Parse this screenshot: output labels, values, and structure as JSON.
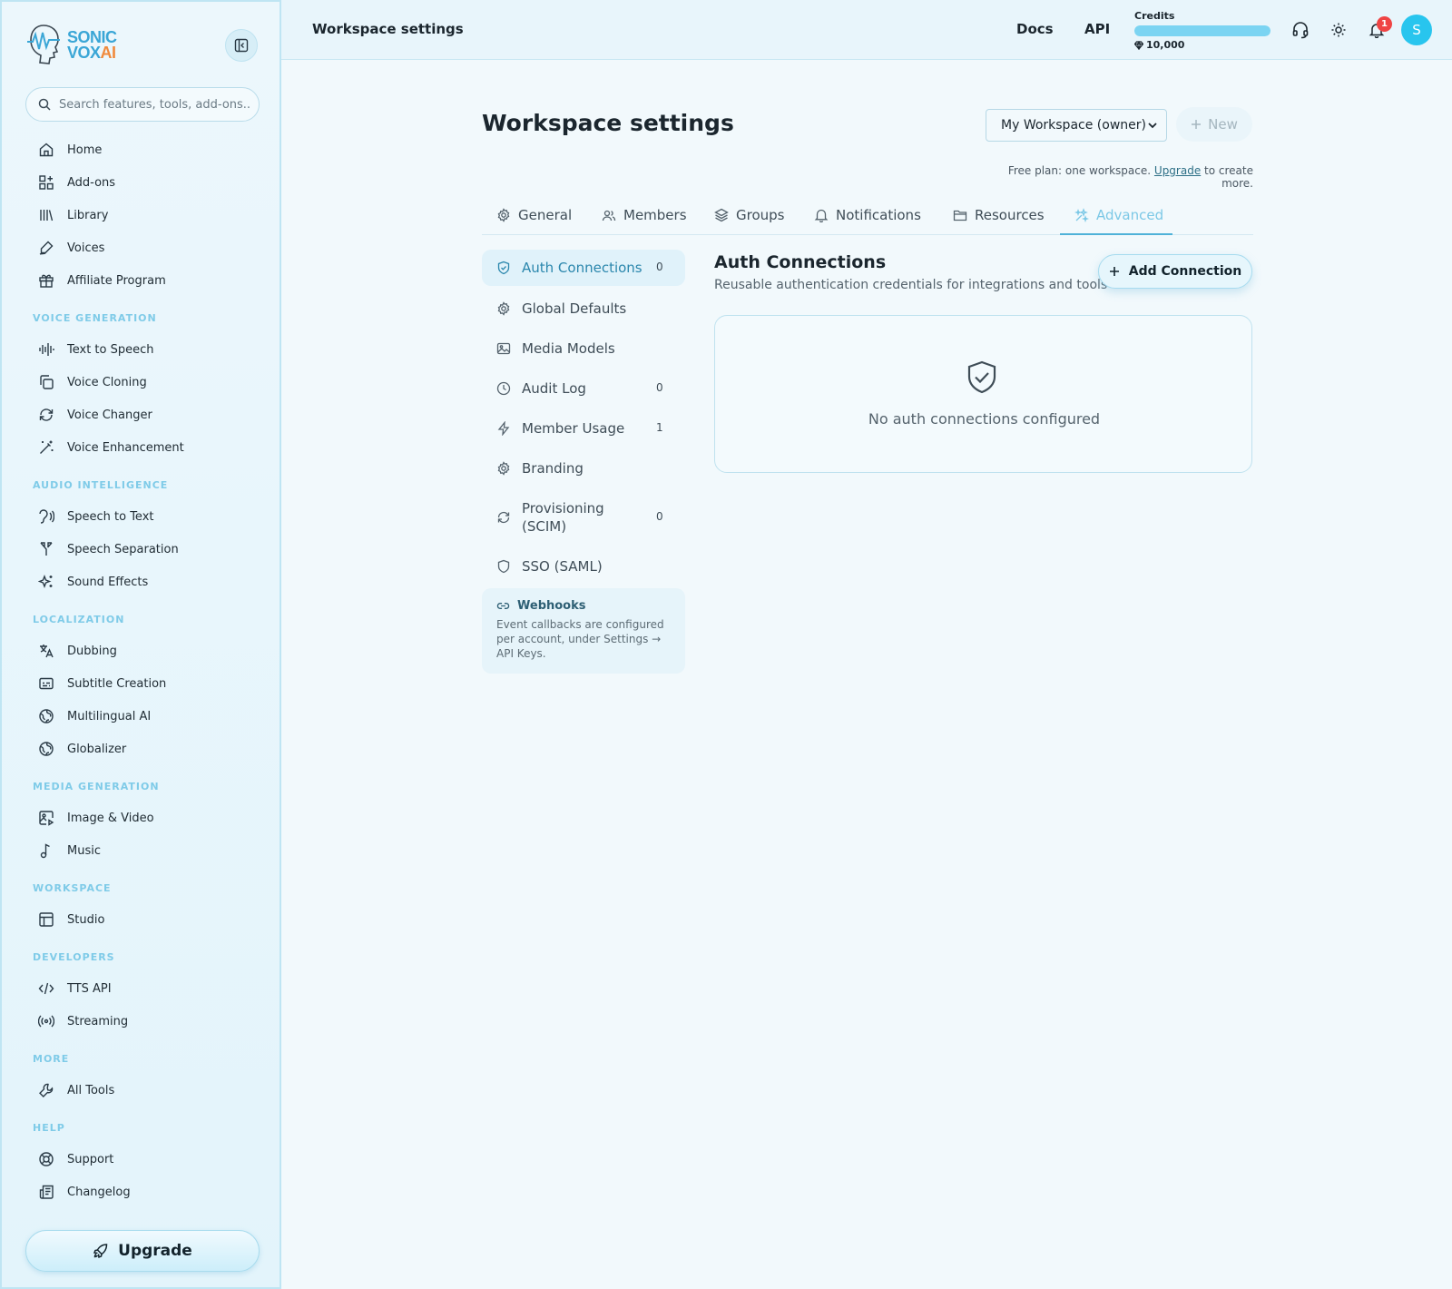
{
  "brand": {
    "line1": "SONIC",
    "line2": "VOX",
    "line2_accent": "AI"
  },
  "search": {
    "placeholder": "Search features, tools, add-ons..."
  },
  "sidebar": {
    "main": [
      {
        "label": "Home",
        "icon": "home-icon"
      },
      {
        "label": "Add-ons",
        "icon": "grid-plus-icon"
      },
      {
        "label": "Library",
        "icon": "library-icon"
      },
      {
        "label": "Voices",
        "icon": "voice-pen-icon"
      },
      {
        "label": "Affiliate Program",
        "icon": "gift-icon"
      }
    ],
    "sections": [
      {
        "title": "VOICE GENERATION",
        "items": [
          "Text to Speech",
          "Voice Cloning",
          "Voice Changer",
          "Voice Enhancement"
        ]
      },
      {
        "title": "AUDIO INTELLIGENCE",
        "items": [
          "Speech to Text",
          "Speech Separation",
          "Sound Effects"
        ]
      },
      {
        "title": "LOCALIZATION",
        "items": [
          "Dubbing",
          "Subtitle Creation",
          "Multilingual AI",
          "Globalizer"
        ]
      },
      {
        "title": "MEDIA GENERATION",
        "items": [
          "Image & Video",
          "Music"
        ]
      },
      {
        "title": "WORKSPACE",
        "items": [
          "Studio"
        ]
      },
      {
        "title": "DEVELOPERS",
        "items": [
          "TTS API",
          "Streaming"
        ]
      },
      {
        "title": "MORE",
        "items": [
          "All Tools"
        ]
      },
      {
        "title": "HELP",
        "items": [
          "Support",
          "Changelog"
        ]
      }
    ],
    "upgrade_label": "Upgrade"
  },
  "header": {
    "title": "Workspace settings",
    "docs": "Docs",
    "api": "API",
    "credits_label": "Credits",
    "credits_value": "10,000",
    "credits_fill_percent": 100,
    "notification_count": "1",
    "avatar_initial": "S"
  },
  "page": {
    "title": "Workspace settings",
    "workspace_select": "My Workspace (owner)",
    "new_label": "New",
    "plan_note_prefix": "Free plan: one workspace.",
    "plan_note_link": "Upgrade",
    "plan_note_suffix": "to create more."
  },
  "tabs": [
    {
      "label": "General",
      "icon": "gear-icon"
    },
    {
      "label": "Members",
      "icon": "users-icon"
    },
    {
      "label": "Groups",
      "icon": "layers-icon"
    },
    {
      "label": "Notifications",
      "icon": "bell-icon"
    },
    {
      "label": "Resources",
      "icon": "folder-icon"
    },
    {
      "label": "Advanced",
      "icon": "sparkle-icon",
      "active": true
    }
  ],
  "subnav": [
    {
      "label": "Auth Connections",
      "count": "0",
      "active": true
    },
    {
      "label": "Global Defaults",
      "count": ""
    },
    {
      "label": "Media Models",
      "count": ""
    },
    {
      "label": "Audit Log",
      "count": "0"
    },
    {
      "label": "Member Usage",
      "count": "1"
    },
    {
      "label": "Branding",
      "count": ""
    },
    {
      "label": "Provisioning (SCIM)",
      "count": "0"
    },
    {
      "label": "SSO (SAML)",
      "count": ""
    }
  ],
  "webhooks": {
    "title": "Webhooks",
    "text": "Event callbacks are configured per account, under Settings → API Keys."
  },
  "auth": {
    "title": "Auth Connections",
    "subtitle": "Reusable authentication credentials for integrations and tools",
    "add_label": "Add Connection",
    "empty_text": "No auth connections configured"
  },
  "colors": {
    "accent": "#4fb2d8",
    "brand_blue": "#3aa6d6",
    "brand_orange": "#f08a3c",
    "badge_red": "#ef4444",
    "avatar": "#28c5ee"
  }
}
